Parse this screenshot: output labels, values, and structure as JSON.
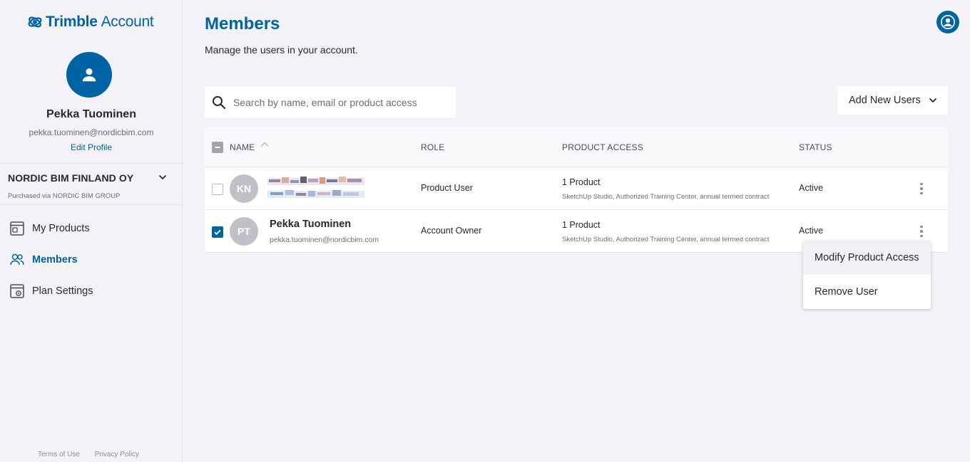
{
  "brand": {
    "name": "Trimble",
    "product": "Account"
  },
  "profile": {
    "name": "Pekka Tuominen",
    "email": "pekka.tuominen@nordicbim.com",
    "edit_label": "Edit Profile"
  },
  "organization": {
    "name": "NORDIC BIM FINLAND OY",
    "purchased_via": "Purchased via NORDIC BIM GROUP"
  },
  "nav": {
    "items": [
      {
        "label": "My Products",
        "icon": "products-icon",
        "active": false
      },
      {
        "label": "Members",
        "icon": "members-icon",
        "active": true
      },
      {
        "label": "Plan Settings",
        "icon": "plan-settings-icon",
        "active": false
      }
    ]
  },
  "footer": {
    "terms": "Terms of Use",
    "privacy": "Privacy Policy"
  },
  "page": {
    "title": "Members",
    "subtitle": "Manage the users in your account."
  },
  "search": {
    "placeholder": "Search by name, email or product access",
    "value": ""
  },
  "add_users": {
    "label": "Add New Users"
  },
  "table": {
    "columns": [
      "NAME",
      "ROLE",
      "PRODUCT ACCESS",
      "STATUS"
    ],
    "rows": [
      {
        "initials": "KN",
        "name": "",
        "email": "",
        "role": "Product User",
        "access": "1 Product",
        "access_detail": "SketchUp Studio, Authorized Training Center, annual termed contract",
        "status": "Active",
        "checked": false
      },
      {
        "initials": "PT",
        "name": "Pekka Tuominen",
        "email": "pekka.tuominen@nordicbim.com",
        "role": "Account Owner",
        "access": "1 Product",
        "access_detail": "SketchUp Studio, Authorized Training Center, annual termed contract",
        "status": "Active",
        "checked": true
      }
    ]
  },
  "row_menu": {
    "items": [
      "Modify Product Access",
      "Remove User"
    ]
  },
  "colors": {
    "brand_blue": "#0063a3",
    "background": "#f3f3f7",
    "avatar_gray": "#c0c0c6"
  }
}
